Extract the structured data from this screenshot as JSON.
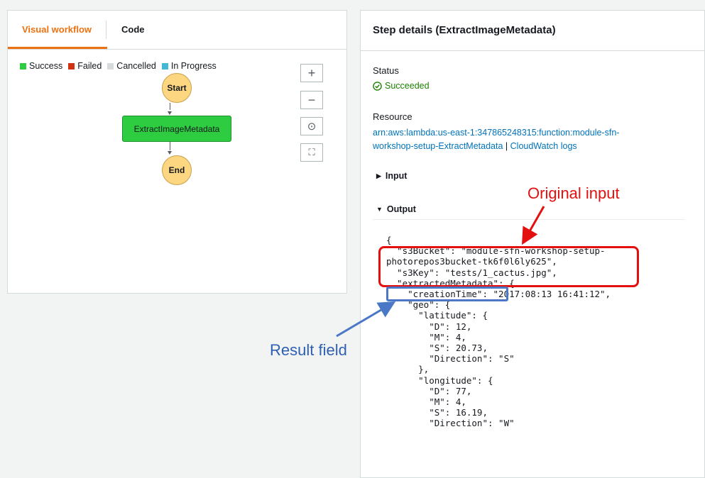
{
  "tabs": {
    "visual": "Visual workflow",
    "code": "Code"
  },
  "legend": [
    {
      "label": "Success",
      "color": "#2ecc40"
    },
    {
      "label": "Failed",
      "color": "#d13212"
    },
    {
      "label": "Cancelled",
      "color": "#d5dbdb"
    },
    {
      "label": "In Progress",
      "color": "#44b9d6"
    }
  ],
  "zoom_controls": {
    "zoom_in": "+",
    "zoom_out": "−",
    "center": "⊙",
    "fit": "⛶"
  },
  "graph": {
    "start": "Start",
    "task": "ExtractImageMetadata",
    "end": "End"
  },
  "details": {
    "title": "Step details (ExtractImageMetadata)",
    "status_label": "Status",
    "status_value": "Succeeded",
    "resource_label": "Resource",
    "resource_line1": "arn:aws:lambda:us-east-1:347865248315:function:module-sfn-",
    "resource_line2": "workshop-setup-ExtractMetadata",
    "separator": "|",
    "cloudwatch_link": "CloudWatch logs",
    "input_label": "Input",
    "output_label": "Output"
  },
  "output_json": [
    "{",
    "  \"s3Bucket\": \"module-sfn-workshop-setup-",
    "photorepos3bucket-tk6f0l6ly625\",",
    "  \"s3Key\": \"tests/1_cactus.jpg\",",
    "  \"extractedMetadata\": {",
    "    \"creationTime\": \"2017:08:13 16:41:12\",",
    "    \"geo\": {",
    "      \"latitude\": {",
    "        \"D\": 12,",
    "        \"M\": 4,",
    "        \"S\": 20.73,",
    "        \"Direction\": \"S\"",
    "      },",
    "      \"longitude\": {",
    "        \"D\": 77,",
    "        \"M\": 4,",
    "        \"S\": 16.19,",
    "        \"Direction\": \"W\""
  ],
  "annotations": {
    "original_input": "Original input",
    "result_field": "Result field",
    "red_color": "#e3100f",
    "blue_color": "#4a78c7"
  }
}
